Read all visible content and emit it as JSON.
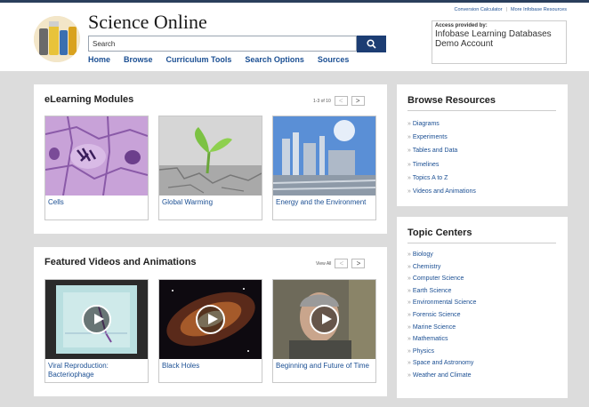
{
  "header": {
    "site_title": "Science Online",
    "search_placeholder": "Search",
    "nav": [
      "Home",
      "Browse",
      "Curriculum Tools",
      "Search Options",
      "Sources"
    ],
    "utility_links": [
      "Conversion Calculator",
      "More Infobase Resources"
    ],
    "access_label": "Access provided by:",
    "access_name": "Infobase Learning Databases Demo Account"
  },
  "elearning": {
    "title": "eLearning Modules",
    "pager": "1-3 of 10",
    "prev": "<",
    "next": ">",
    "cards": [
      {
        "label": "Cells"
      },
      {
        "label": "Global Warming"
      },
      {
        "label": "Energy and the Environment"
      }
    ]
  },
  "videos": {
    "title": "Featured Videos and Animations",
    "view_all": "View All",
    "prev": "<",
    "next": ">",
    "cards": [
      {
        "label": "Viral Reproduction: Bacteriophage"
      },
      {
        "label": "Black Holes"
      },
      {
        "label": "Beginning and Future of Time"
      }
    ]
  },
  "browse": {
    "title": "Browse Resources",
    "items": [
      "Diagrams",
      "Experiments",
      "Tables and Data",
      "Timelines",
      "Topics A to Z",
      "Videos and Animations"
    ]
  },
  "topics": {
    "title": "Topic Centers",
    "items": [
      "Biology",
      "Chemistry",
      "Computer Science",
      "Earth Science",
      "Environmental Science",
      "Forensic Science",
      "Marine Science",
      "Mathematics",
      "Physics",
      "Space and Astronomy",
      "Weather and Climate"
    ]
  },
  "colors": {
    "accent": "#1c3d73",
    "link": "#1b4f93",
    "background": "#dcdcdc"
  }
}
